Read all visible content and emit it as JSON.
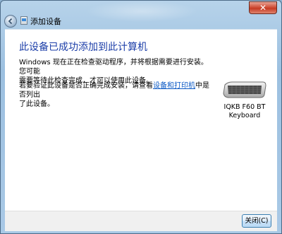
{
  "window": {
    "title": "添加设备"
  },
  "content": {
    "heading": "此设备已成功添加到此计算机",
    "paragraph1_line1": "Windows 现在正在检查驱动程序，并将根据需要进行安装。您可能",
    "paragraph1_line2": "需要等待此检查完成，才可以使用此设备。",
    "paragraph2_prefix": "若要验证此设备是否正确完成安装，请查看",
    "paragraph2_link": "设备和打印机",
    "paragraph2_suffix": "中是否列出",
    "paragraph2_line2": "了此设备。"
  },
  "device": {
    "name_line1": "IQKB F60 BT",
    "name_line2": "Keyboard",
    "icon": "keyboard-icon"
  },
  "footer": {
    "close_label": "关闭(C)"
  },
  "colors": {
    "heading": "#1c3ea8",
    "link": "#0b59c5",
    "close_x": "#c53b24"
  }
}
